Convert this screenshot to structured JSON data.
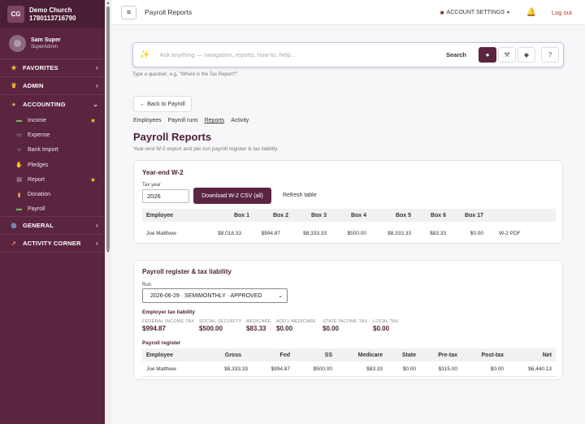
{
  "org": {
    "badge": "CG",
    "name": "Demo Church",
    "id": "1780113716790"
  },
  "user": {
    "name": "Sam Super",
    "role": "SuperAdmin"
  },
  "sidebar": {
    "sections": [
      {
        "label": "FAVORITES",
        "icon": "star-icon"
      },
      {
        "label": "ADMIN",
        "icon": "crown-icon"
      },
      {
        "label": "ACCOUNTING",
        "icon": "money-bag-icon"
      },
      {
        "label": "GENERAL",
        "icon": "globe-icon"
      },
      {
        "label": "ACTIVITY CORNER",
        "icon": "rocket-icon"
      }
    ],
    "accounting_items": [
      {
        "label": "Income",
        "icon": "cash-icon",
        "favorite": true
      },
      {
        "label": "Expense",
        "icon": "card-icon",
        "favorite": false
      },
      {
        "label": "Bank Import",
        "icon": "bank-icon",
        "favorite": false
      },
      {
        "label": "Pledges",
        "icon": "handshake-icon",
        "favorite": false
      },
      {
        "label": "Report",
        "icon": "report-icon",
        "favorite": true
      },
      {
        "label": "Donation",
        "icon": "donation-icon",
        "favorite": false
      },
      {
        "label": "Payroll",
        "icon": "payroll-icon",
        "favorite": false
      }
    ]
  },
  "header": {
    "menu_icon": "≡",
    "title": "Payroll Reports",
    "account_settings": "ACCOUNT SETTINGS",
    "logout": "Log out"
  },
  "search": {
    "placeholder": "Ask anything — navigation, reports, how-to, help...",
    "label": "Search",
    "hint": "Type a question, e.g. \"Where is the Tax Report?\""
  },
  "nav": {
    "back": "← Back to Payroll",
    "tabs": [
      "Employees",
      "Payroll runs",
      "Reports",
      "Activity"
    ],
    "active_tab": "Reports"
  },
  "page": {
    "title": "Payroll Reports",
    "subtitle": "Year-end W-2 export and per-run payroll register & tax liability."
  },
  "w2": {
    "title": "Year-end W-2",
    "tax_year_label": "Tax year",
    "tax_year": "2026",
    "download_label": "Download W-2 CSV (all)",
    "refresh_label": "Refresh table",
    "columns": [
      "Employee",
      "Box 1",
      "Box 2",
      "Box 3",
      "Box 4",
      "Box 5",
      "Box 6",
      "Box 17",
      ""
    ],
    "rows": [
      [
        "Joe Matthew",
        "$8,018.33",
        "$994.87",
        "$8,333.33",
        "$500.00",
        "$8,333.33",
        "$83.33",
        "$0.00",
        "W-2 PDF"
      ]
    ]
  },
  "register": {
    "title": "Payroll register & tax liability",
    "run_label": "Run",
    "run_value": "2026-06-29 · SEMIMONTHLY · APPROVED",
    "employer_tax_title": "Employer tax liability",
    "taxes": [
      {
        "label": "FEDERAL INCOME TAX",
        "value": "$994.87"
      },
      {
        "label": "SOCIAL SECURITY",
        "value": "$500.00"
      },
      {
        "label": "MEDICARE",
        "value": "$83.33"
      },
      {
        "label": "ADD'L MEDICARE",
        "value": "$0.00"
      },
      {
        "label": "STATE INCOME TAX",
        "value": "$0.00"
      },
      {
        "label": "LOCAL TAX",
        "value": "$0.00"
      }
    ],
    "register_title": "Payroll register",
    "columns": [
      "Employee",
      "Gross",
      "Fed",
      "SS",
      "Medicare",
      "State",
      "Pre-tax",
      "Post-tax",
      "Net"
    ],
    "rows": [
      [
        "Joe Matthew",
        "$8,333.33",
        "$994.87",
        "$500.00",
        "$83.33",
        "$0.00",
        "$315.00",
        "$0.00",
        "$6,440.13"
      ]
    ]
  },
  "colors": {
    "brand": "#5b2540",
    "brand_dark": "#4a1e35",
    "logout": "#c0392b",
    "favorite_star": "#f2c230"
  }
}
